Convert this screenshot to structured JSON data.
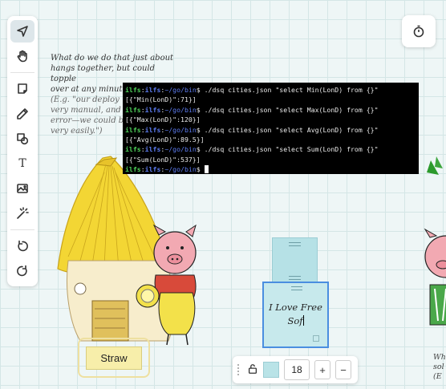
{
  "toolbar": {
    "tools": [
      {
        "name": "select-tool",
        "icon": "cursor-arrow-icon",
        "active": true
      },
      {
        "name": "hand-tool",
        "icon": "hand-icon"
      },
      {
        "name": "sticky-note-tool",
        "icon": "sticky-note-icon"
      },
      {
        "name": "pen-tool",
        "icon": "pencil-icon"
      },
      {
        "name": "shape-tool",
        "icon": "shapes-icon"
      },
      {
        "name": "text-tool",
        "icon": "text-icon",
        "label": "T"
      },
      {
        "name": "image-tool",
        "icon": "image-icon"
      },
      {
        "name": "magic-tool",
        "icon": "magic-wand-icon"
      },
      {
        "name": "undo-tool",
        "icon": "undo-icon"
      },
      {
        "name": "redo-tool",
        "icon": "redo-icon"
      }
    ]
  },
  "timer": {
    "icon": "timer-icon"
  },
  "canvas_text": {
    "line1": "What do we do that just about",
    "line2": "hangs together, but could topple",
    "line3": "over at any minute?",
    "sub1": "(E.g. \"our deploy",
    "sub2": "very manual, and",
    "sub3": "error—we could bre",
    "sub4": "very easily.\")"
  },
  "terminal": {
    "user": "ilfs",
    "host": "ilfs",
    "path": "~/go/bin",
    "lines": [
      {
        "type": "cmd",
        "cmd": "./dsq cities.json \"select Min(LonD) from {}\""
      },
      {
        "type": "out",
        "text": "[{\"Min(LonD)\":71}]"
      },
      {
        "type": "cmd",
        "cmd": "./dsq cities.json \"select Max(LonD) from {}\""
      },
      {
        "type": "out",
        "text": "[{\"Max(LonD)\":120}]"
      },
      {
        "type": "cmd",
        "cmd": "./dsq cities.json \"select Avg(LonD) from {}\""
      },
      {
        "type": "out",
        "text": "[{\"Avg(LonD)\":89.5}]"
      },
      {
        "type": "cmd",
        "cmd": "./dsq cities.json \"select Sum(LonD) from {}\""
      },
      {
        "type": "out",
        "text": "[{\"Sum(LonD)\":537}]"
      },
      {
        "type": "prompt",
        "cmd": ""
      }
    ]
  },
  "note": {
    "line1": "I Love Free",
    "line2": "Sof"
  },
  "straw_label": "Straw",
  "format_bar": {
    "font_size": "18",
    "plus": "+",
    "minus": "−",
    "swatch_color": "#b9e3e7"
  },
  "right_partial": {
    "line1": "Wh",
    "line2": "sol",
    "line3": "(E"
  }
}
